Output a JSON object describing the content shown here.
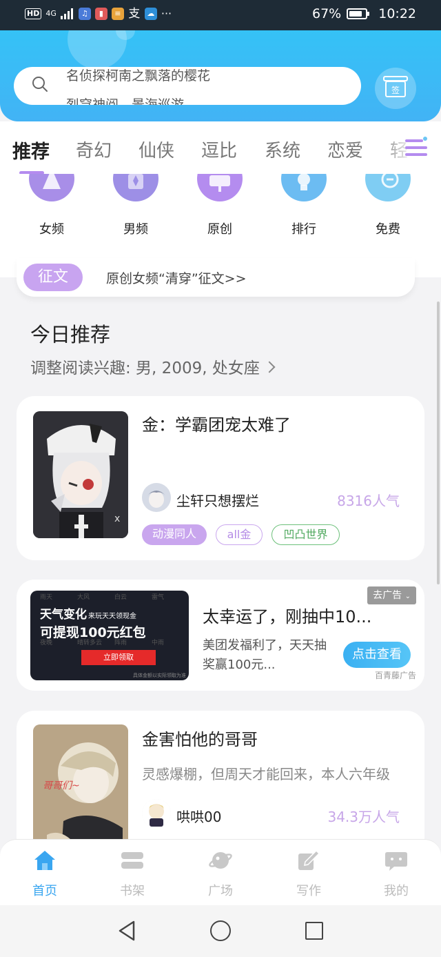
{
  "status_bar": {
    "hd": "HD",
    "network": "4G",
    "battery": "67%",
    "time": "10:22",
    "more": "···",
    "app_icons": [
      "music-app-icon",
      "red-book-app-icon",
      "news-app-icon",
      "alipay-app-icon",
      "weather-app-icon"
    ]
  },
  "header": {
    "search_lines": [
      "名侦探柯南之飘落的樱花",
      "烈穹神阅，景海巡游"
    ],
    "gift_label": "签"
  },
  "category_tabs": [
    "推荐",
    "奇幻",
    "仙侠",
    "逗比",
    "系统",
    "恋爱",
    "轻"
  ],
  "active_tab": 0,
  "quick_entries": [
    {
      "label": "女频",
      "icon": "female-channel-icon",
      "color": "#a88ee8"
    },
    {
      "label": "男频",
      "icon": "male-channel-icon",
      "color": "#9d8fe6"
    },
    {
      "label": "原创",
      "icon": "original-icon",
      "color": "#b48cef"
    },
    {
      "label": "排行",
      "icon": "ranking-icon",
      "color": "#6cbcf2"
    },
    {
      "label": "免费",
      "icon": "free-icon",
      "color": "#7fcdf3"
    }
  ],
  "contest": {
    "tag": "征文",
    "text": "原创女频“清穿”征文>>"
  },
  "today": {
    "title": "今日推荐",
    "subtitle": "调整阅读兴趣: 男, 2009, 处女座"
  },
  "books": [
    {
      "title": "金：学霸团宠太难了",
      "author": "尘轩只想摆烂",
      "popularity": "8316人气",
      "tags": [
        {
          "label": "动漫同人",
          "style": "filled-purple"
        },
        {
          "label": "all金",
          "style": "outline-purple"
        },
        {
          "label": "凹凸世界",
          "style": "outline-green"
        }
      ]
    },
    {
      "title": "金害怕他的哥哥",
      "description": "灵感爆棚，但周天才能回来，本人六年级",
      "author": "哄哄00",
      "popularity": "34.3万人气",
      "cover_text": "哥哥们~"
    }
  ],
  "ad": {
    "image_headline": "天气变化",
    "image_sub": "来玩天天领现金",
    "image_main": "可提现100元红包",
    "image_button": "立即领取",
    "image_grid": [
      "雨天",
      "大风",
      "白云",
      "雷气",
      "夜晚",
      "晴转多云",
      "阵雨",
      "中雨"
    ],
    "image_footnote": "具体金额以实际领取为准",
    "title": "太幸运了，刚抽中10...",
    "description": "美团发福利了，天天抽奖赢100元...",
    "close_label": "去广告",
    "cta": "点击查看",
    "source": "百青藤广告"
  },
  "bottom_nav": [
    {
      "label": "首页",
      "icon": "home-icon",
      "active": true
    },
    {
      "label": "书架",
      "icon": "bookshelf-icon",
      "active": false
    },
    {
      "label": "广场",
      "icon": "planet-icon",
      "active": false
    },
    {
      "label": "写作",
      "icon": "pen-icon",
      "active": false
    },
    {
      "label": "我的",
      "icon": "chat-bubble-icon",
      "active": false
    }
  ],
  "colors": {
    "header_blue": "#35c2f6",
    "accent_purple": "#b48bef",
    "nav_active": "#3aa6f0",
    "popularity": "#c7a6e8"
  }
}
